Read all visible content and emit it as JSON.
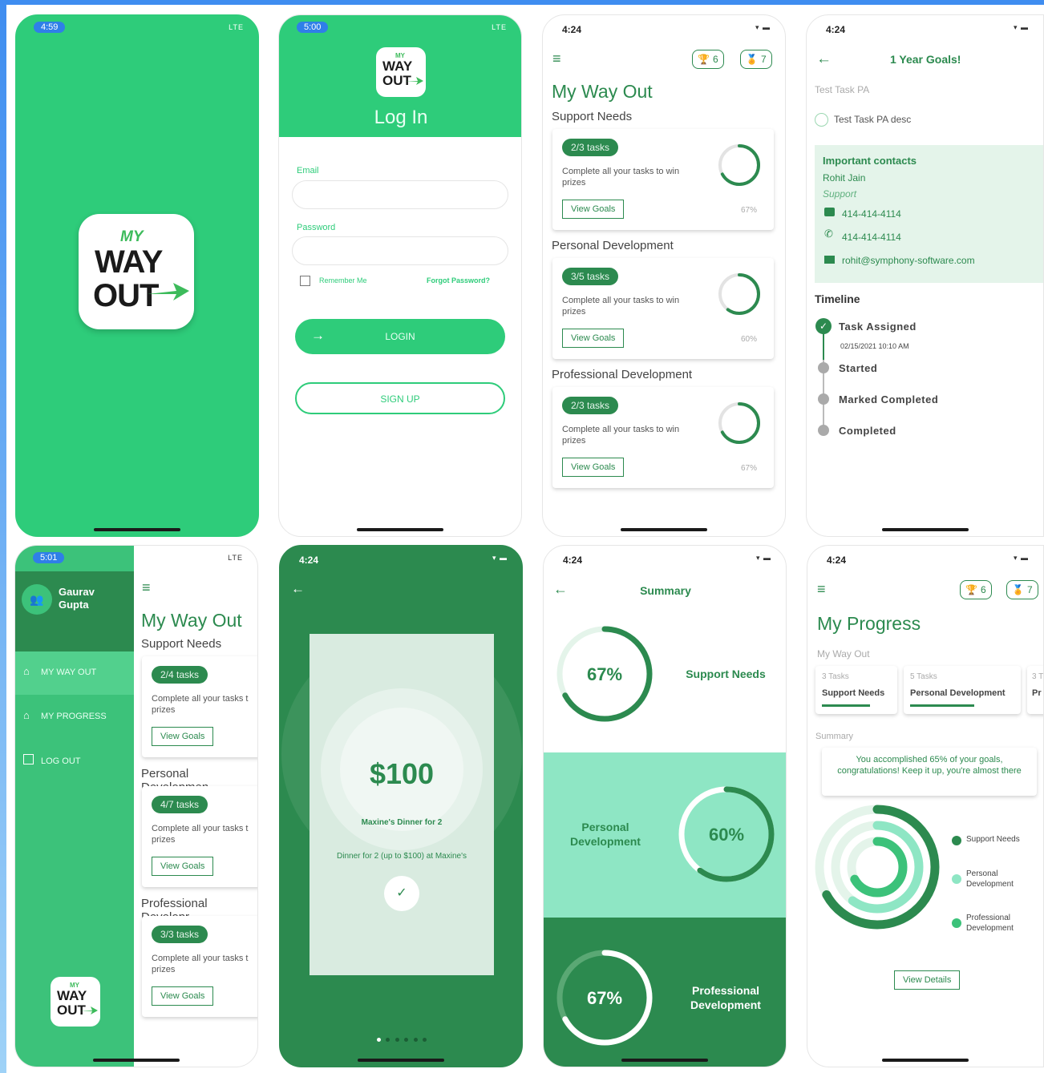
{
  "colors": {
    "brand_green": "#2ecc7a",
    "dark_green": "#2c8a4f",
    "mint": "#8ee6c4",
    "accent_blue": "#2f7fe8"
  },
  "logo": {
    "line1": "MY",
    "line2": "WAY",
    "line3": "OUT"
  },
  "screen1": {
    "status_time": "4:59",
    "status_right": "LTE"
  },
  "screen2": {
    "status_time": "5:00",
    "status_right": "LTE",
    "title": "Log In",
    "email_label": "Email",
    "password_label": "Password",
    "remember_label": "Remember Me",
    "forgot_label": "Forgot Password?",
    "login_label": "LOGIN",
    "signup_label": "SIGN UP"
  },
  "screen3": {
    "status_time": "4:24",
    "trophy_count": "6",
    "award_count": "7",
    "title": "My Way Out",
    "sections": [
      {
        "title": "Support Needs",
        "chip": "2/3 tasks",
        "desc": "Complete all your tasks to win prizes",
        "button": "View Goals",
        "pct": "67%",
        "value": 0.67
      },
      {
        "title": "Personal Development",
        "chip": "3/5 tasks",
        "desc": "Complete all your tasks to win prizes",
        "button": "View Goals",
        "pct": "60%",
        "value": 0.6
      },
      {
        "title": "Professional Development",
        "chip": "2/3 tasks",
        "desc": "Complete all your tasks to win prizes",
        "button": "View Goals",
        "pct": "67%",
        "value": 0.67
      }
    ]
  },
  "screen4": {
    "status_time": "4:24",
    "title": "1 Year Goals!",
    "task_name": "Test Task PA",
    "task_desc": "Test Task PA desc",
    "contacts_title": "Important contacts",
    "contact_name": "Rohit  Jain",
    "contact_role": "Support",
    "contact_sms": "414-414-4114",
    "contact_phone": "414-414-4114",
    "contact_email": "rohit@symphony-software.com",
    "timeline_title": "Timeline",
    "timeline": [
      {
        "label": "Task Assigned",
        "sub": "02/15/2021 10:10 AM"
      },
      {
        "label": "Started",
        "sub": ""
      },
      {
        "label": "Marked Completed",
        "sub": ""
      },
      {
        "label": "Completed",
        "sub": ""
      }
    ]
  },
  "screen5": {
    "status_time": "5:01",
    "status_right": "LTE",
    "user_name": "Gaurav Gupta",
    "menu": [
      "MY WAY OUT",
      "MY PROGRESS",
      "LOG OUT"
    ],
    "title": "My Way Out",
    "sections": [
      {
        "title": "Support Needs",
        "chip": "2/4 tasks",
        "desc": "Complete all your tasks t prizes",
        "button": "View Goals"
      },
      {
        "title": "Personal Developmen",
        "chip": "4/7 tasks",
        "desc": "Complete all your tasks t prizes",
        "button": "View Goals"
      },
      {
        "title": "Professional Developr",
        "chip": "3/3 tasks",
        "desc": "Complete all your tasks t prizes",
        "button": "View Goals"
      }
    ]
  },
  "screen6": {
    "status_time": "4:24",
    "amount": "$100",
    "reward_title": "Maxine's Dinner for 2",
    "reward_desc": "Dinner for 2 (up to $100) at Maxine's",
    "page_count": 6,
    "active_page": 0
  },
  "screen7": {
    "status_time": "4:24",
    "title": "Summary",
    "items": [
      {
        "label": "Support Needs",
        "pct": "67%",
        "value": 0.67
      },
      {
        "label": "Personal Development",
        "pct": "60%",
        "value": 0.6
      },
      {
        "label": "Professional Development",
        "pct": "67%",
        "value": 0.67
      }
    ]
  },
  "screen8": {
    "status_time": "4:24",
    "trophy_count": "6",
    "award_count": "7",
    "title": "My Progress",
    "subtitle": "My Way Out",
    "tabs": [
      {
        "count": "3 Tasks",
        "label": "Support Needs"
      },
      {
        "count": "5 Tasks",
        "label": "Personal Development"
      },
      {
        "count": "3 T",
        "label": "Pr"
      }
    ],
    "summary_label": "Summary",
    "summary_text": "You accomplished 65% of your goals, congratulations! Keep it up, you're almost there",
    "legend": [
      "Support Needs",
      "Personal Development",
      "Professional Development"
    ],
    "view_details": "View Details"
  }
}
